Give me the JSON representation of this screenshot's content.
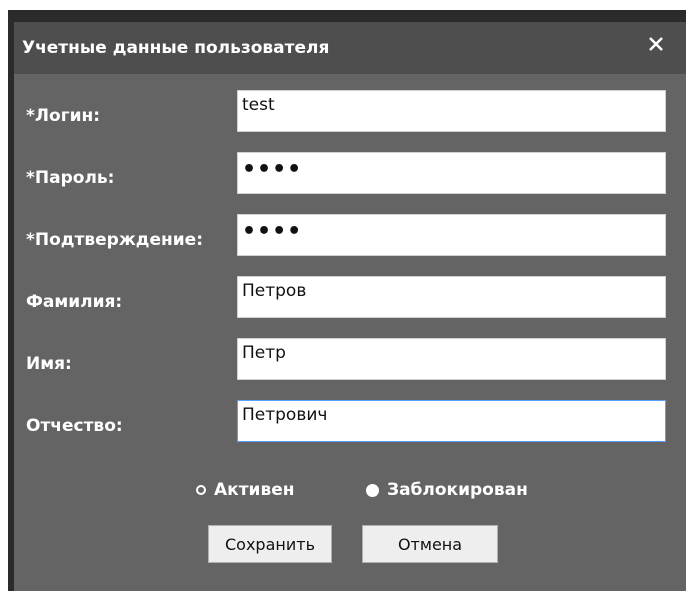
{
  "dialog": {
    "title": "Учетные данные пользователя",
    "close_symbol": "close-icon"
  },
  "fields": [
    {
      "label": "*Логин:",
      "value": "test",
      "masked": false
    },
    {
      "label": "*Пароль:",
      "value": "••••",
      "masked": true
    },
    {
      "label": "*Подтверждение:",
      "value": "••••",
      "masked": true
    },
    {
      "label": "Фамилия:",
      "value": "Петров",
      "masked": false
    },
    {
      "label": "Имя:",
      "value": "Петр",
      "masked": false
    },
    {
      "label": "Отчество:",
      "value": "Петрович",
      "masked": false
    }
  ],
  "status": {
    "options": [
      {
        "label": "Активен",
        "selected": false
      },
      {
        "label": "Заблокирован",
        "selected": true
      }
    ]
  },
  "buttons": {
    "save_label": "Сохранить",
    "cancel_label": "Отмена"
  },
  "colors": {
    "dialog_bg": "#646464",
    "titlebar_bg": "#4e4e4e",
    "focus_border": "#5aa0ff"
  }
}
